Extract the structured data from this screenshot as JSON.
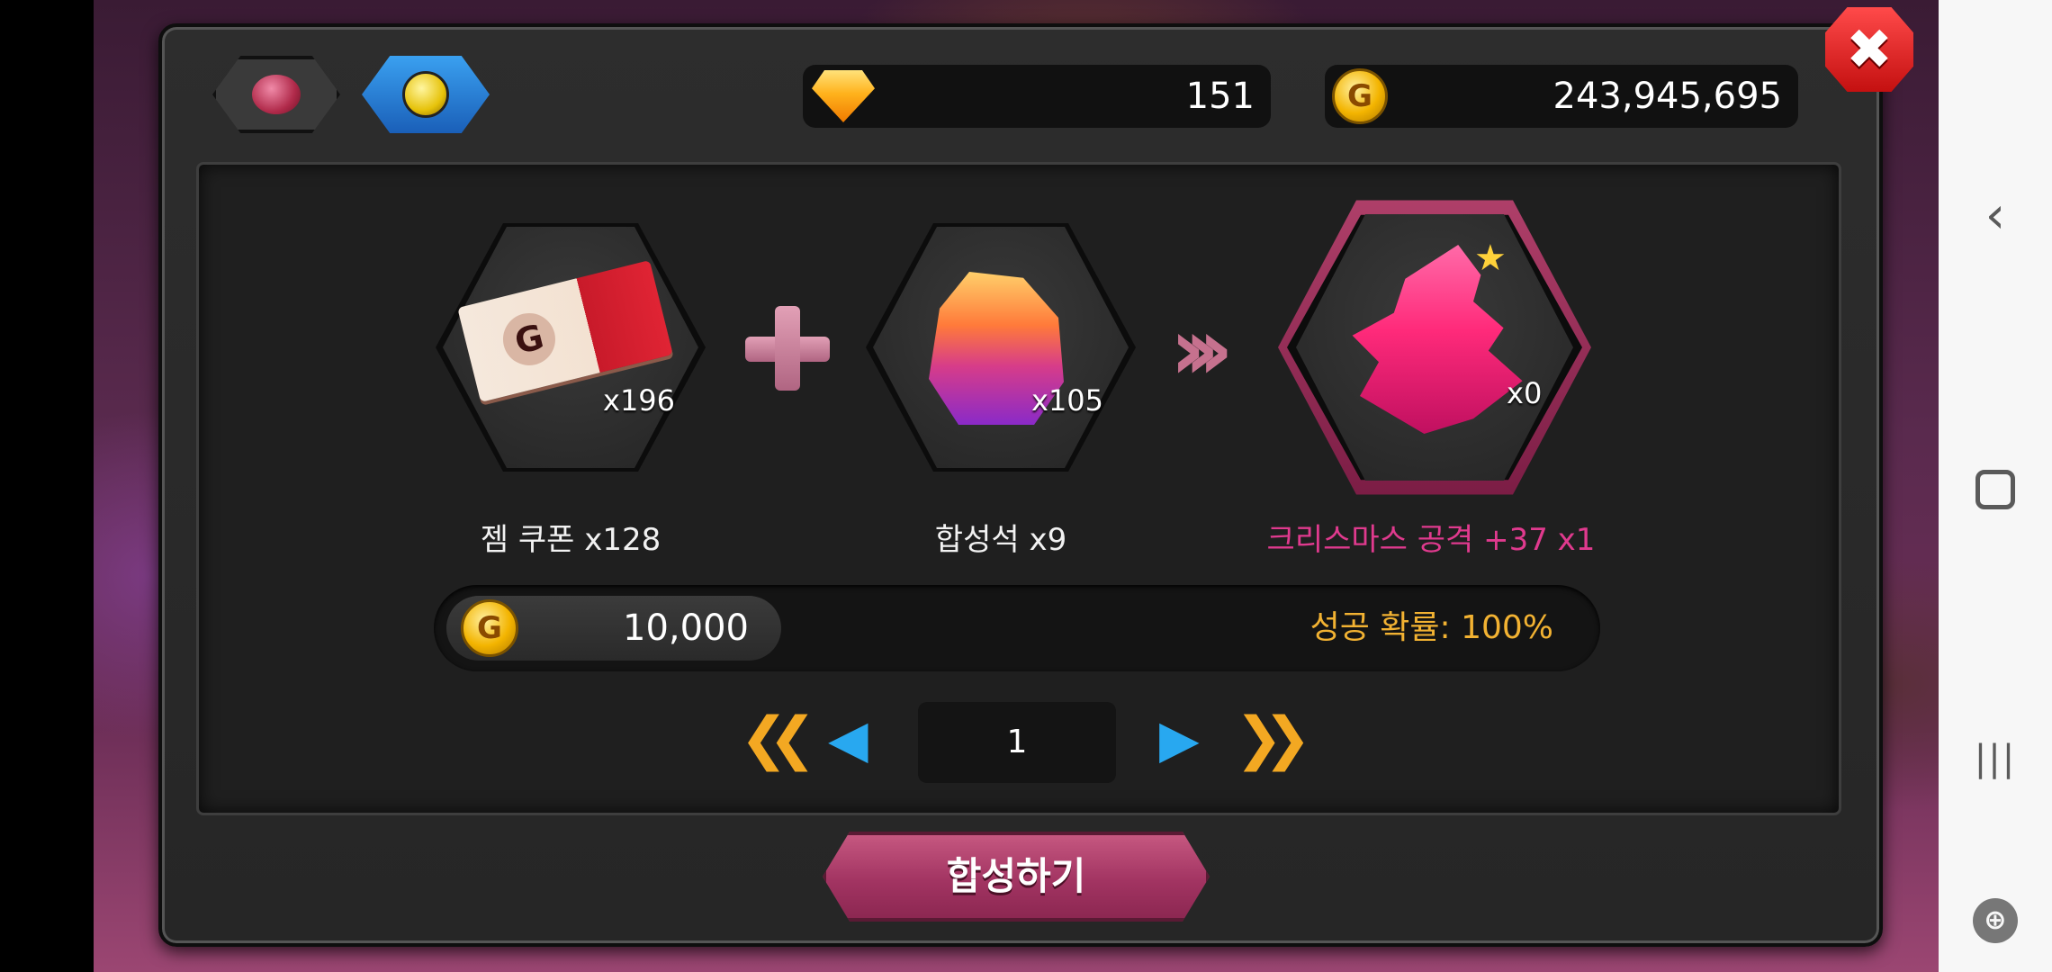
{
  "header": {
    "tabs": [
      {
        "icon": "gem-icon"
      },
      {
        "icon": "potion-icon"
      }
    ],
    "gems": "151",
    "gold": "243,945,695"
  },
  "synthesis": {
    "ingredient1": {
      "count": "x196",
      "label": "젬 쿠폰 x128"
    },
    "ingredient2": {
      "count": "x105",
      "label": "합성석 x9"
    },
    "result": {
      "count": "x0",
      "label": "크리스마스 공격 +37 x1"
    },
    "cost": "10,000",
    "success_rate": "성공 확률: 100%",
    "page": "1",
    "button_label": "합성하기"
  },
  "colors": {
    "result_label": "#e03a8e",
    "success_rate": "#f2b232",
    "accent_button": "#a23462"
  }
}
